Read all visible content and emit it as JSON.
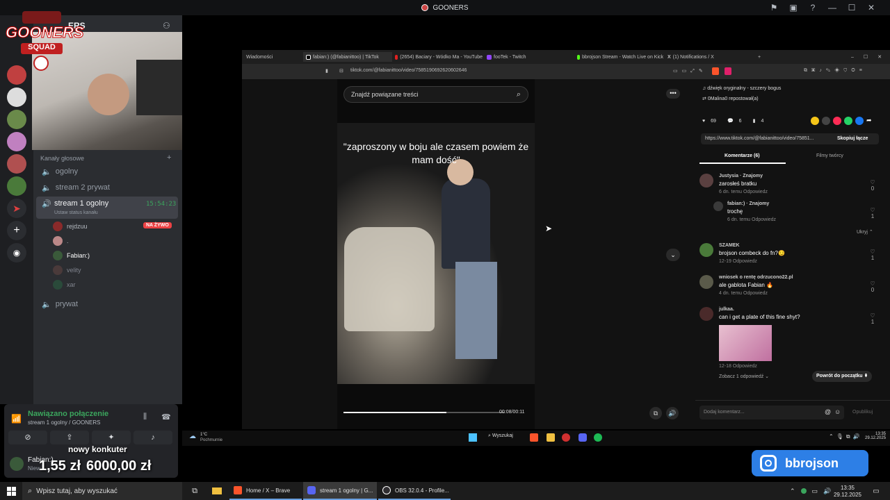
{
  "titlebar": {
    "title": "GOONERS"
  },
  "overlay": {
    "logo_text_1": "GOONERS",
    "logo_text_2": "SQUAD",
    "instagram": "bbrojson",
    "new_follower_label": "nowy konkuter",
    "amount_1": "1,55 zł",
    "amount_2": "6000,00 zł"
  },
  "server_header": {
    "name": "ERS"
  },
  "voice": {
    "section_label": "Kanały głosowe",
    "channels": [
      {
        "name": "ogolny"
      },
      {
        "name": "stream 2 prywat"
      },
      {
        "name": "stream 1 ogolny",
        "time": "15:54:23",
        "status_hint": "Ustaw status kanału"
      },
      {
        "name": "prywat"
      }
    ],
    "users": [
      {
        "name": "rejdzuu",
        "badge": "NA ŻYWO"
      },
      {
        "name": "."
      },
      {
        "name": "Fabian:)"
      },
      {
        "name": "velity"
      },
      {
        "name": "xar"
      }
    ],
    "connected": {
      "status": "Nawiązano połączenie",
      "channel": "stream 1 ogolny / GOONERS"
    },
    "user_panel": {
      "name": "Fabian:)",
      "sub": "Niew"
    }
  },
  "browser": {
    "tabs": [
      {
        "label": "Wiadomości"
      },
      {
        "label": "fabian:) (@fabianittoo) | TikTok"
      },
      {
        "label": "(2654) Baciary - Wódko Ma - YouTube"
      },
      {
        "label": "fooTek - Twitch"
      },
      {
        "label": "bbrojson Stream - Watch Live on Kick"
      },
      {
        "label": "(1) Notifications / X"
      }
    ],
    "url": "tiktok.com/@fabianittoo/video/7585190692620602646",
    "search_placeholder": "Znajdź powiązane treści",
    "caption": "\"zaproszony w boju ale czasem powiem że mam dość\"",
    "video_time": "00:08/00:11",
    "sound": "dźwięk oryginalny - szczery bogus",
    "repost": "0Malina0 repostował(a)",
    "counts": {
      "likes": "69",
      "comments": "6",
      "saves": "4"
    },
    "share_url": "https://www.tiktok.com/@fabianittoo/video/75851...",
    "copy_link": "Skopiuj łącze",
    "tab_comments": "Komentarze (6)",
    "tab_creator": "Filmy twórcy",
    "comments": [
      {
        "author": "Justysia · Znajomy",
        "text": "zarosłeś bratku",
        "meta": "6 dn. temu    Odpowiedz",
        "likes": "0"
      },
      {
        "author": "fabian:) · Znajomy",
        "text": "trochę",
        "meta": "6 dn. temu    Odpowiedz",
        "likes": "1"
      },
      {
        "author": "SZAMEK",
        "text": "brojson combeck do fn?😏",
        "meta": "12-19    Odpowiedz",
        "likes": "1"
      },
      {
        "author": "wniosek o rentę odrzucono22.pl",
        "text": "ale gablota Fabian 🔥",
        "meta": "4 dn. temu    Odpowiedz",
        "likes": "0"
      },
      {
        "author": "julkaa.",
        "text": "can i get a plate of this fine shyt?",
        "meta": "12-18    Odpowiedz",
        "likes": "1"
      }
    ],
    "hide": "Ukryj",
    "see_replies": "Zobacz 1 odpowiedź",
    "back_to_top": "Powrót do początku",
    "add_comment": "Dodaj komentarz...",
    "publish": "Opublikuj"
  },
  "inner_taskbar": {
    "weather_temp": "1°C",
    "weather_desc": "Pochmurnie",
    "search": "Wyszukaj",
    "time": "13:35",
    "date": "29.12.2025"
  },
  "taskbar": {
    "search_placeholder": "Wpisz tutaj, aby wyszukać",
    "apps": [
      {
        "label": "Home / X – Brave"
      },
      {
        "label": "stream 1 ogolny | G..."
      },
      {
        "label": "OBS 32.0.4 - Profile..."
      }
    ],
    "time": "13:35",
    "date": "29.12.2025"
  }
}
